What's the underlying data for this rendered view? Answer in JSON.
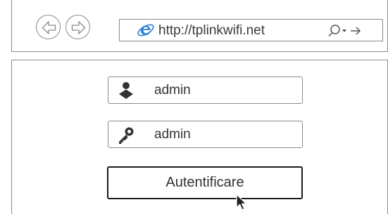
{
  "browser": {
    "url": "http://tplinkwifi.net",
    "back_icon": "back-arrow-icon",
    "forward_icon": "forward-arrow-icon",
    "page_icon": "internet-explorer-icon",
    "search_icon": "search-icon",
    "dropdown_icon": "dropdown-triangle-icon",
    "go_icon": "go-arrow-icon"
  },
  "login": {
    "username_value": "admin",
    "username_icon": "user-icon",
    "password_value": "admin",
    "password_icon": "key-icon",
    "submit_label": "Autentificare",
    "cursor_icon": "mouse-pointer-icon"
  },
  "colors": {
    "border": "#8a8a8a",
    "button_border": "#1a1a1a",
    "icon_fill": "#333333",
    "ie_blue": "#2a7fd4"
  }
}
